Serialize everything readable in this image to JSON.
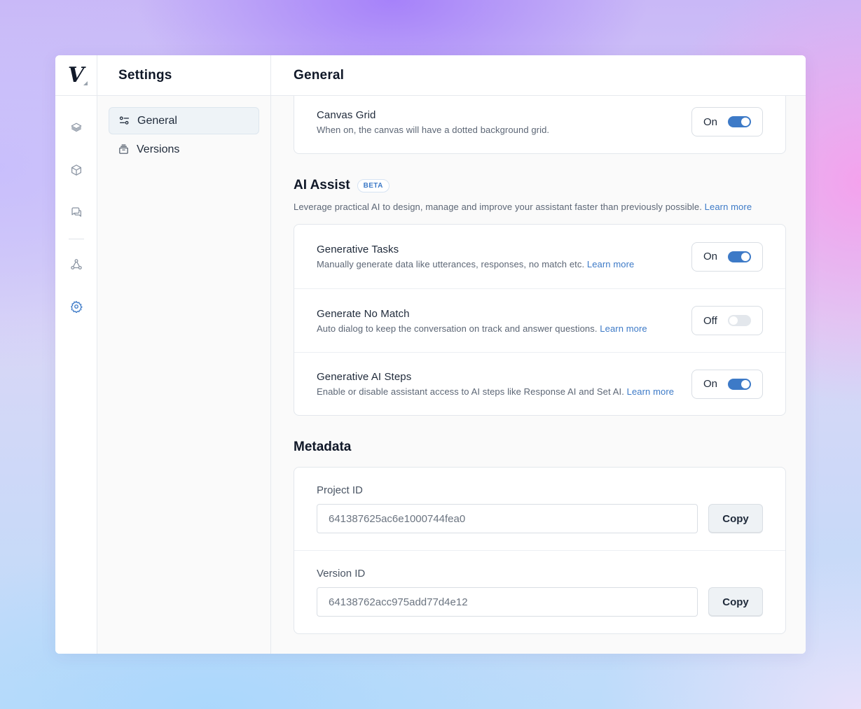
{
  "rail": {
    "logo": "V",
    "icons": [
      "layers-icon",
      "cube-icon",
      "chat-icon",
      "workflow-icon",
      "settings-icon"
    ]
  },
  "subnav": {
    "title": "Settings",
    "items": [
      {
        "label": "General",
        "icon": "sliders-icon",
        "active": true
      },
      {
        "label": "Versions",
        "icon": "archive-icon",
        "active": false
      }
    ]
  },
  "main": {
    "title": "General",
    "canvas_grid": {
      "title": "Canvas Grid",
      "desc": "When on, the canvas will have a dotted background grid.",
      "toggle": "On"
    },
    "ai_assist": {
      "title": "AI Assist",
      "badge": "BETA",
      "desc": "Leverage practical AI to design, manage and improve your assistant faster than previously possible.",
      "link": "Learn more",
      "rows": [
        {
          "title": "Generative Tasks",
          "desc": "Manually generate data like utterances, responses, no match etc.",
          "link": "Learn more",
          "toggle": "On"
        },
        {
          "title": "Generate No Match",
          "desc": "Auto dialog to keep the conversation on track and answer questions.",
          "link": "Learn more",
          "toggle": "Off"
        },
        {
          "title": "Generative AI Steps",
          "desc": "Enable or disable assistant access to AI steps like Response AI and Set AI.",
          "link": "Learn more",
          "toggle": "On"
        }
      ]
    },
    "metadata": {
      "title": "Metadata",
      "project": {
        "label": "Project ID",
        "value": "641387625ac6e1000744fea0",
        "button": "Copy"
      },
      "version": {
        "label": "Version ID",
        "value": "64138762acc975add77d4e12",
        "button": "Copy"
      }
    }
  },
  "colors": {
    "accent": "#3d7ac7",
    "text": "#1f2a3a",
    "muted": "#5c6675"
  }
}
